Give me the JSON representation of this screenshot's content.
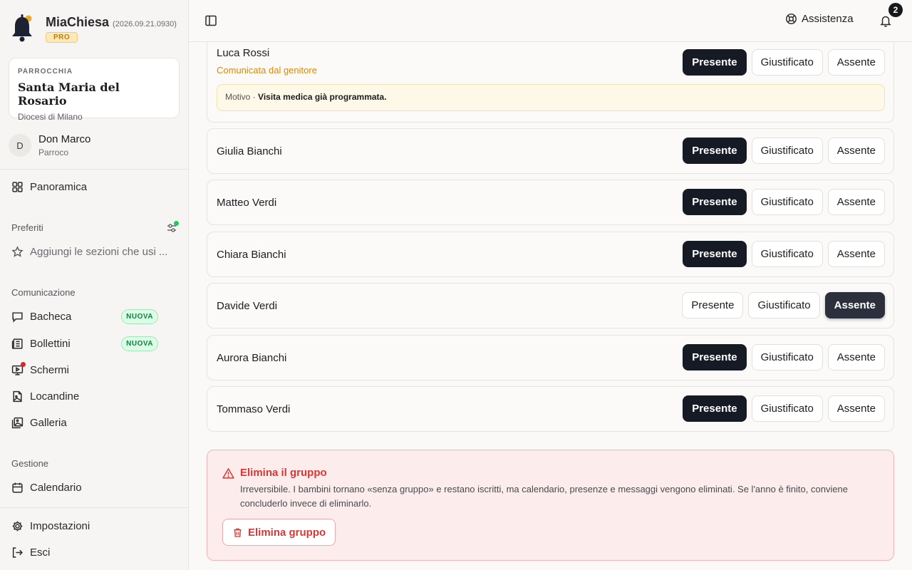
{
  "brand": {
    "name": "MiaChiesa",
    "version": "(2026.09.21.0930)",
    "badge": "PRO"
  },
  "parish": {
    "label": "PARROCCHIA",
    "name": "Santa Maria del Rosario",
    "diocese": "Diocesi di Milano"
  },
  "user": {
    "initial": "D",
    "name": "Don Marco",
    "role": "Parroco"
  },
  "nav": {
    "overview": "Panoramica",
    "favorites_label": "Preferiti",
    "favorites_placeholder": "Aggiungi le sezioni che usi ...",
    "communication_label": "Comunicazione",
    "bacheca": "Bacheca",
    "bollettini": "Bollettini",
    "schermi": "Schermi",
    "locandine": "Locandine",
    "galleria": "Galleria",
    "management_label": "Gestione",
    "calendario": "Calendario",
    "settings": "Impostazioni",
    "logout": "Esci",
    "new_badge": "NUOVA"
  },
  "topbar": {
    "help": "Assistenza",
    "notifications_count": "2"
  },
  "attendance": {
    "labels": {
      "present": "Presente",
      "justified": "Giustificato",
      "absent": "Assente"
    },
    "rows": [
      {
        "name": "Luca Rossi",
        "note": "Comunicata dal genitore",
        "reason_label": "Motivo ·",
        "reason": "Visita medica già programmata.",
        "status": "present"
      },
      {
        "name": "Giulia Bianchi",
        "status": "present"
      },
      {
        "name": "Matteo Verdi",
        "status": "present"
      },
      {
        "name": "Chiara Bianchi",
        "status": "present"
      },
      {
        "name": "Davide Verdi",
        "status": "absent"
      },
      {
        "name": "Aurora Bianchi",
        "status": "present"
      },
      {
        "name": "Tommaso Verdi",
        "status": "present"
      }
    ]
  },
  "danger": {
    "title": "Elimina il gruppo",
    "text": "Irreversibile. I bambini tornano «senza gruppo» e restano iscritti, ma calendario, presenze e messaggi vengono eliminati. Se l'anno è finito, conviene concluderlo invece di eliminarlo.",
    "button": "Elimina gruppo"
  },
  "colors": {
    "accent_dark": "#161a25",
    "warning": "#d98a0b",
    "danger": "#d93636",
    "new_green": "#15803d"
  }
}
